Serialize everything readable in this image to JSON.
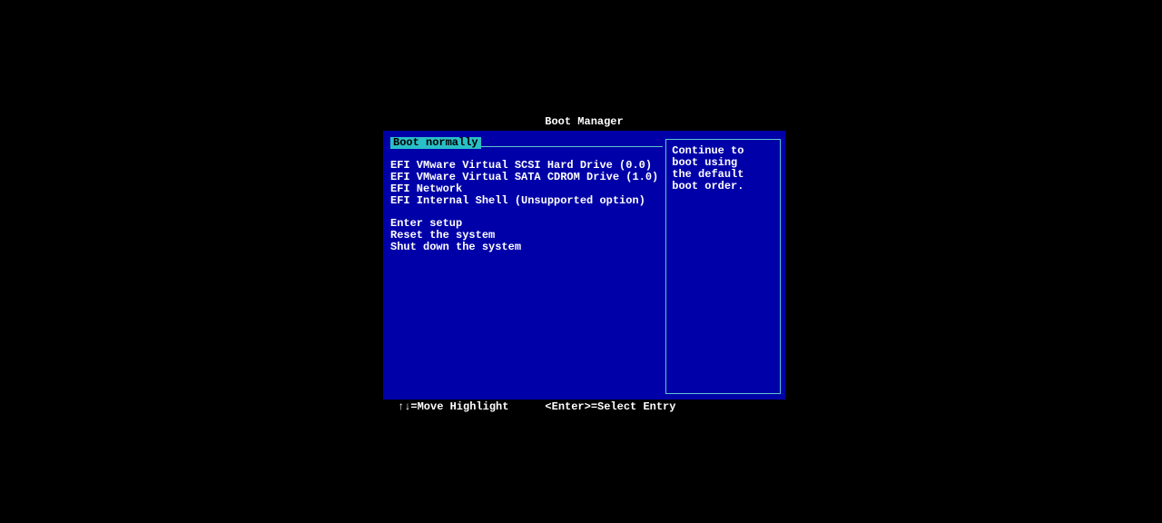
{
  "title": "Boot Manager",
  "selected": "Boot normally",
  "menu": {
    "group1": [
      "EFI VMware Virtual SCSI Hard Drive (0.0)",
      "EFI VMware Virtual SATA CDROM Drive (1.0)",
      "EFI Network",
      "EFI Internal Shell (Unsupported option)"
    ],
    "group2": [
      "Enter setup",
      "Reset the system",
      "Shut down the system"
    ]
  },
  "help": {
    "line1": "Continue to boot using",
    "line2": "the default boot order."
  },
  "hints": {
    "move": "↑↓=Move Highlight",
    "select": "<Enter>=Select Entry"
  }
}
